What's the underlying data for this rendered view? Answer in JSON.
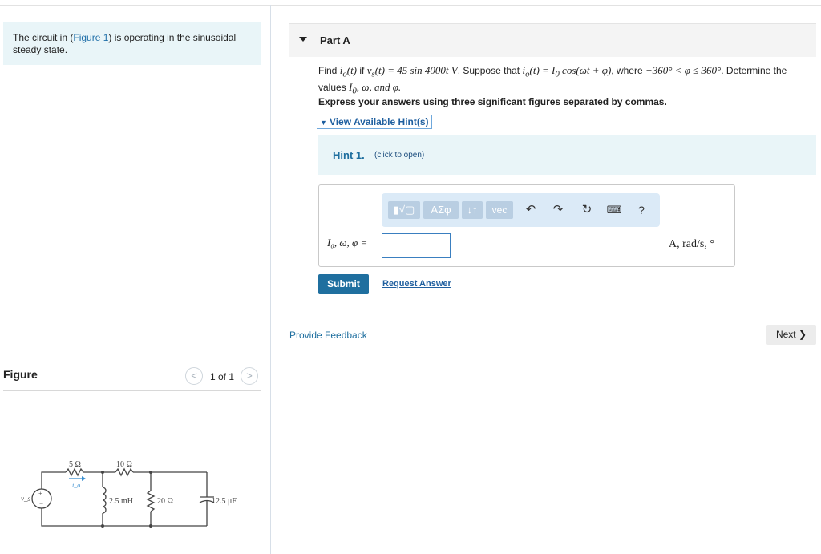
{
  "intro": {
    "before": "The circuit in (",
    "link": "Figure 1",
    "after": ") is operating in the sinusoidal steady state."
  },
  "figure_panel": {
    "title": "Figure",
    "pager": "1 of 1",
    "prev_glyph": "<",
    "next_glyph": ">"
  },
  "circuit": {
    "source_label": "v_s",
    "source_plus": "+",
    "source_minus": "−",
    "r1": "5 Ω",
    "r2": "10 Ω",
    "current_label": "i_o",
    "inductor": "2.5 mH",
    "r3": "20 Ω",
    "capacitor": "12.5 μF"
  },
  "part": {
    "title": "Part A",
    "question_find": "Find ",
    "question_io_t": "i",
    "question_if": " if ",
    "question_vs_expr": "v",
    "question_vs_rhs": "(t) = 45 sin 4000t V",
    "question_suppose": ". Suppose that ",
    "question_io_expr": "(t) = I",
    "question_cos": " cos(ωt + φ)",
    "question_where": ", where ",
    "question_range": "−360° < φ ≤ 360°",
    "question_determine": ". Determine the values ",
    "question_values": "I",
    "question_values_rest": ", ω, and φ.",
    "instruction": "Express your answers using three significant figures separated by commas.",
    "hint_toggle": "View Available Hint(s)",
    "hint_title": "Hint 1.",
    "hint_sub": "(click to open)"
  },
  "answer": {
    "label": "I₀, ω, φ =",
    "value": "",
    "units": "A, rad/s, °",
    "toolbar": {
      "templates": "▮√▢",
      "greek": "ΑΣφ",
      "arrows": "↓↑",
      "vec": "vec",
      "undo_icon": "undo-icon",
      "redo_icon": "redo-icon",
      "reset_icon": "reset-icon",
      "keyboard_icon": "keyboard-icon",
      "help": "?"
    }
  },
  "actions": {
    "submit": "Submit",
    "request_answer": "Request Answer",
    "feedback": "Provide Feedback",
    "next": "Next"
  },
  "colors": {
    "accent": "#1f6f9f",
    "hint_bg": "#e9f5f8",
    "toolbar_bg": "#dbeaf7"
  }
}
